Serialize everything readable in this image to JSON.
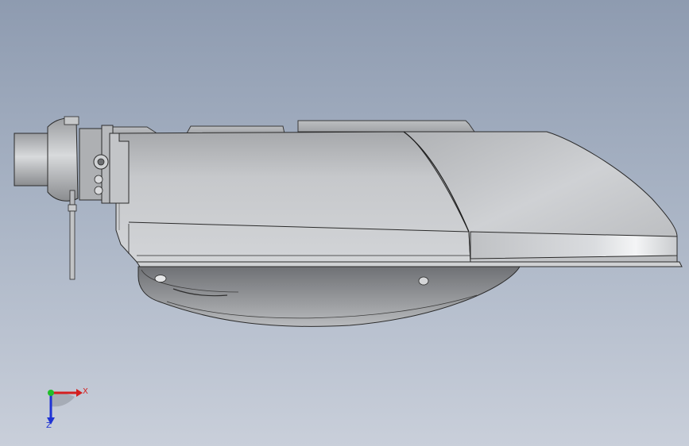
{
  "viewport": {
    "background_top": "#8e9bb0",
    "background_bottom": "#c9cfda"
  },
  "triad": {
    "x_label": "X",
    "z_label": "Z",
    "x_color": "#d41f1f",
    "y_color": "#1fbf2a",
    "z_color": "#1f33d4"
  }
}
